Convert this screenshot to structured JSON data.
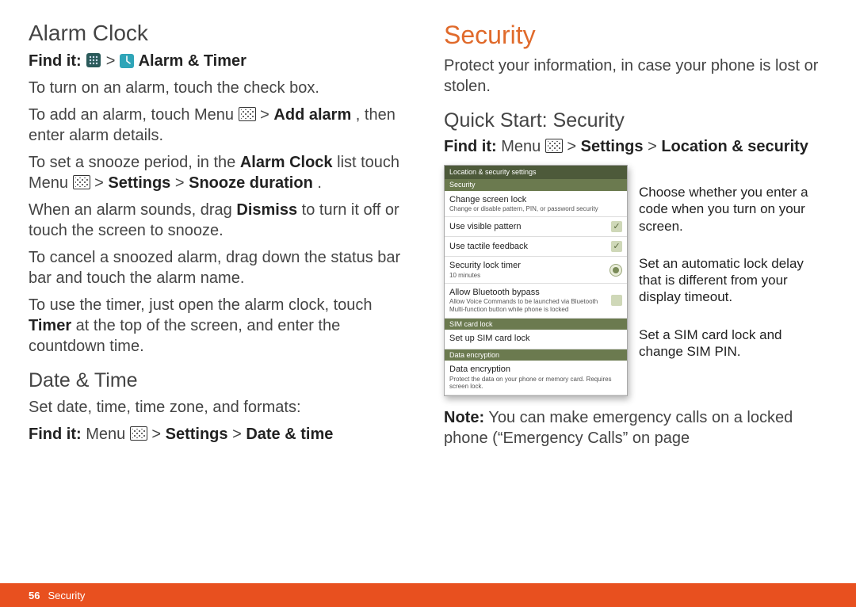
{
  "left": {
    "h_alarm": "Alarm Clock",
    "findit_label": "Find it:",
    "findit_alarm_path": " Alarm & Timer",
    "p1": "To turn on an alarm, touch the check box.",
    "p2a": "To add an alarm, touch Menu ",
    "p2b": " > ",
    "p2_bold1": "Add alarm",
    "p2c": ", then enter alarm details.",
    "p3a": "To set a snooze period, in the ",
    "p3_bold1": "Alarm Clock",
    "p3b": " list touch Menu ",
    "p3c": " > ",
    "p3_bold2": "Settings",
    "p3d": " > ",
    "p3_bold3": "Snooze duration",
    "p3e": ".",
    "p4a": "When an alarm sounds, drag ",
    "p4_bold1": "Dismiss",
    "p4b": " to turn it off or touch the screen to snooze.",
    "p5": "To cancel a snoozed alarm, drag down the status bar bar and touch the alarm name.",
    "p6a": "To use the timer, just open the alarm clock, touch ",
    "p6_bold1": "Timer",
    "p6b": " at the top of the screen, and enter the countdown time.",
    "h_date": "Date & Time",
    "p_date": "Set date, time, time zone, and formats:",
    "findit_date_a": " Menu ",
    "findit_date_b": " > ",
    "findit_date_bold1": "Settings",
    "findit_date_c": " > ",
    "findit_date_bold2": "Date & time"
  },
  "right": {
    "h_sec": "Security",
    "p_intro": "Protect your information, in case your phone is lost or stolen.",
    "h_qs": "Quick Start: Security",
    "findit_label": "Find it:",
    "findit_a": " Menu ",
    "findit_b": " > ",
    "findit_bold1": "Settings",
    "findit_c": " > ",
    "findit_bold2": "Location & security",
    "phone": {
      "titlebar": "Location & security settings",
      "sections": [
        {
          "hdr": "Security",
          "items": [
            {
              "title": "Change screen lock",
              "sub": "Change or disable pattern, PIN, or password security"
            },
            {
              "title": "Use visible pattern",
              "chk": true
            },
            {
              "title": "Use tactile feedback",
              "chk": true
            },
            {
              "title": "Security lock timer",
              "sub": "10 minutes",
              "radio": true
            },
            {
              "title": "Allow Bluetooth bypass",
              "sub": "Allow Voice Commands to be launched via Bluetooth Multi-function button while phone is locked",
              "chk": false
            }
          ]
        },
        {
          "hdr": "SIM card lock",
          "items": [
            {
              "title": "Set up SIM card lock"
            }
          ]
        },
        {
          "hdr": "Data encryption",
          "items": [
            {
              "title": "Data encryption",
              "sub": "Protect the data on your phone or memory card. Requires screen lock."
            }
          ]
        }
      ]
    },
    "callouts": [
      "Choose whether you enter a code when you turn on your screen.",
      "Set an automatic lock delay that is different from your display timeout.",
      "Set a SIM card lock and change SIM PIN."
    ],
    "note_label": "Note:",
    "note_text": " You can make emergency calls on a locked phone (“Emergency Calls” on page"
  },
  "footer": {
    "page": "56",
    "section": "Security"
  }
}
